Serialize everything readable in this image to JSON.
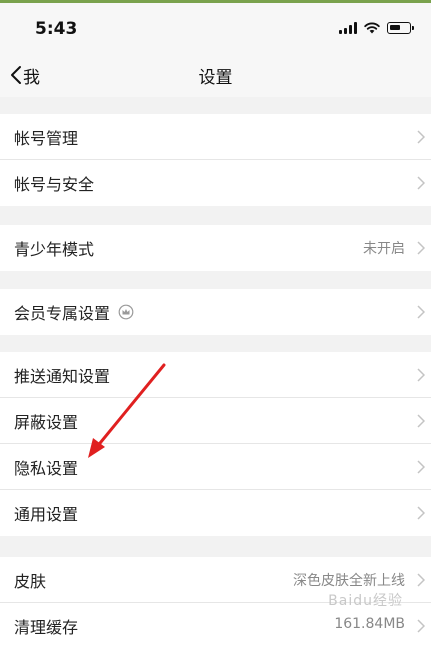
{
  "status": {
    "time": "5:43"
  },
  "nav": {
    "back_label": "我",
    "title": "设置"
  },
  "groups": [
    {
      "items": [
        {
          "label": "帐号管理"
        },
        {
          "label": "帐号与安全"
        }
      ]
    },
    {
      "items": [
        {
          "label": "青少年模式",
          "value": "未开启"
        }
      ]
    },
    {
      "items": [
        {
          "label": "会员专属设置",
          "icon": "vip-crown-icon"
        }
      ]
    },
    {
      "items": [
        {
          "label": "推送通知设置"
        },
        {
          "label": "屏蔽设置"
        },
        {
          "label": "隐私设置"
        },
        {
          "label": "通用设置"
        }
      ]
    },
    {
      "items": [
        {
          "label": "皮肤",
          "value": "深色皮肤全新上线"
        },
        {
          "label": "清理缓存",
          "value": "161.84MB"
        }
      ]
    }
  ],
  "watermark": "Baidu经验",
  "colors": {
    "annotation_arrow": "#e02020",
    "accent_line": "#7aa24d"
  }
}
